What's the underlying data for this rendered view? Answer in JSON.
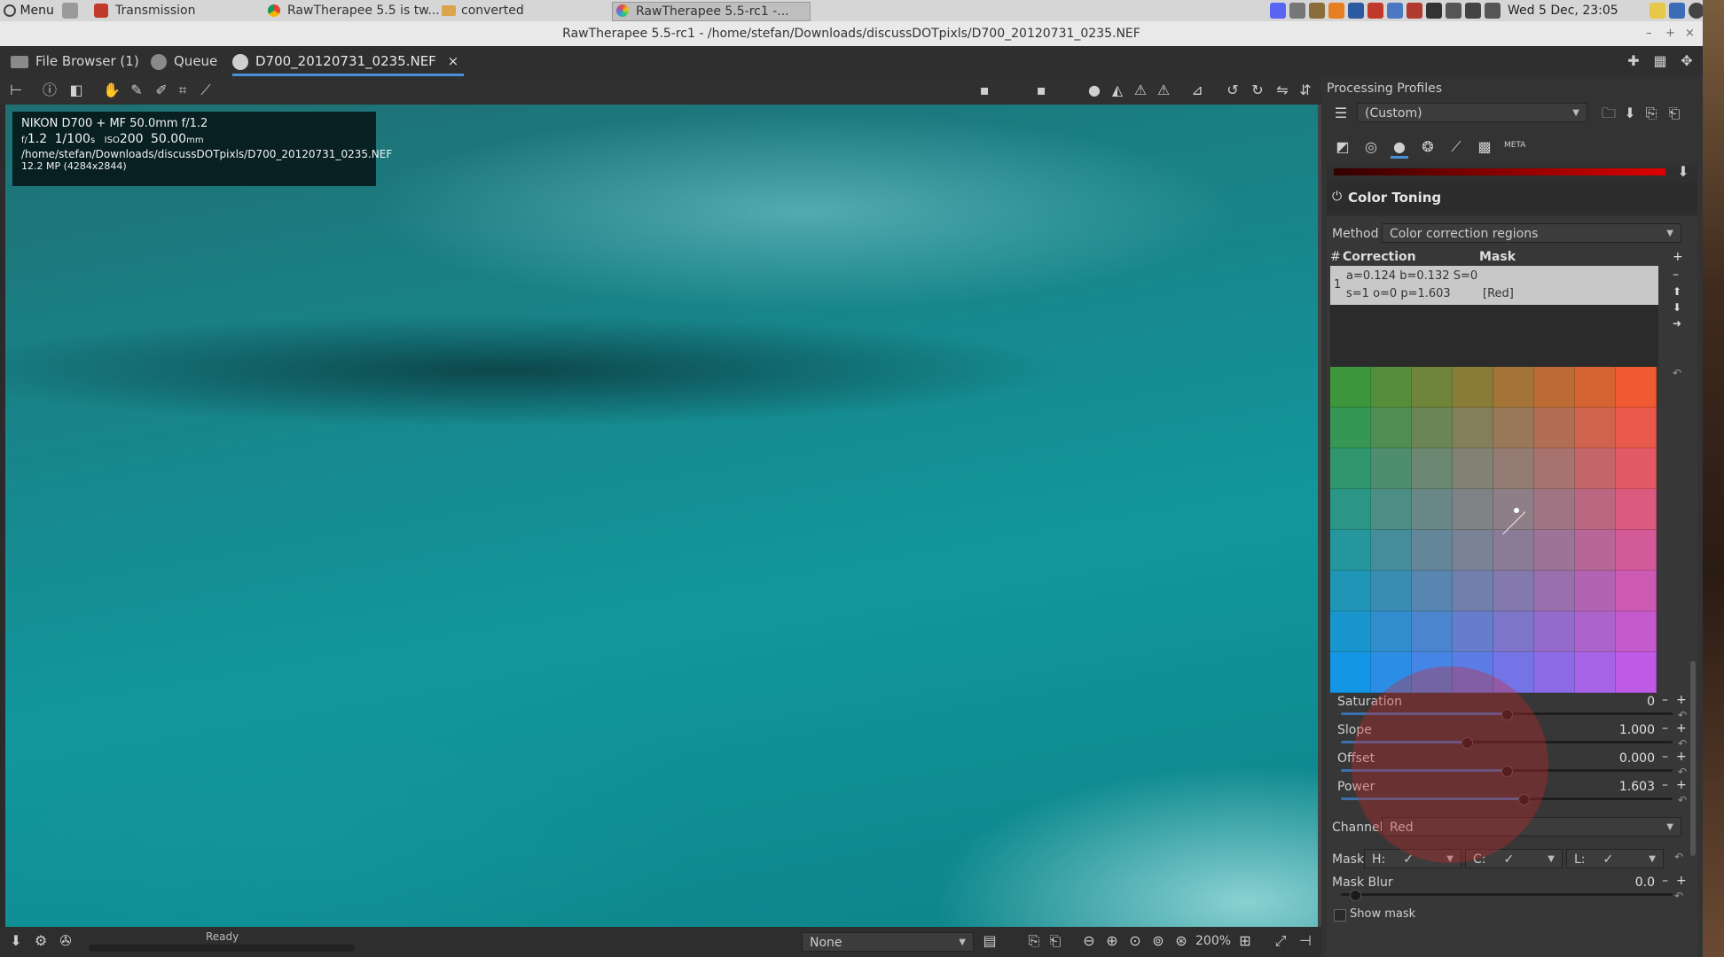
{
  "system_bar": {
    "menu_label": "Menu",
    "tasks": [
      "Transmission",
      "RawTherapee 5.5 is tw...",
      "converted",
      "RawTherapee 5.5-rc1 -..."
    ],
    "clock": "Wed  5 Dec, 23:05"
  },
  "window": {
    "title": "RawTherapee 5.5-rc1 - /home/stefan/Downloads/discussDOTpixls/D700_20120731_0235.NEF"
  },
  "tabs": {
    "file_browser": "File Browser (1)",
    "queue": "Queue",
    "editor": "D700_20120731_0235.NEF",
    "close_glyph": "×"
  },
  "image_info": {
    "camera": "NIKON D700 + MF 50.0mm f/1.2",
    "f_prefix": "f/",
    "aperture": "1.2",
    "shutter": "1/100",
    "shutter_unit": "s",
    "iso_prefix": "ISO",
    "iso": "200",
    "focal": "50.00",
    "focal_unit": "mm",
    "path": "/home/stefan/Downloads/discussDOTpixls/D700_20120731_0235.NEF",
    "megapixels": "12.2 MP (4284x2844)"
  },
  "status": {
    "ready": "Ready",
    "profile_select": "None",
    "zoom": "200%"
  },
  "panel": {
    "processing_profiles_label": "Processing Profiles",
    "profile_value": "(Custom)",
    "section_title": "Color Toning",
    "method_label": "Method",
    "method_value": "Color correction regions",
    "list_header_num": "#",
    "list_header_correction": "Correction",
    "list_header_mask": "Mask",
    "list_row_index": "1",
    "list_row_line1": "a=0.124 b=0.132 S=0",
    "list_row_line2": "s=1 o=0 p=1.603",
    "list_row_mask": "[Red]",
    "sliders": [
      {
        "label": "Saturation",
        "value": "0",
        "level": 0.5
      },
      {
        "label": "Slope",
        "value": "1.000",
        "level": 0.38
      },
      {
        "label": "Offset",
        "value": "0.000",
        "level": 0.5
      },
      {
        "label": "Power",
        "value": "1.603",
        "level": 0.55
      }
    ],
    "channel_label": "Channel:",
    "channel_value": "Red",
    "mask_label": "Mask:",
    "mask_h": "H:",
    "mask_c": "C:",
    "mask_l": "L:",
    "mask_blur_label": "Mask Blur",
    "mask_blur_value": "0.0",
    "show_mask_label": "Show mask",
    "meta_label": "META"
  },
  "colors": {
    "accent": "#4a90d9",
    "panel_bg": "#333333",
    "image_teal": "#11979c"
  }
}
